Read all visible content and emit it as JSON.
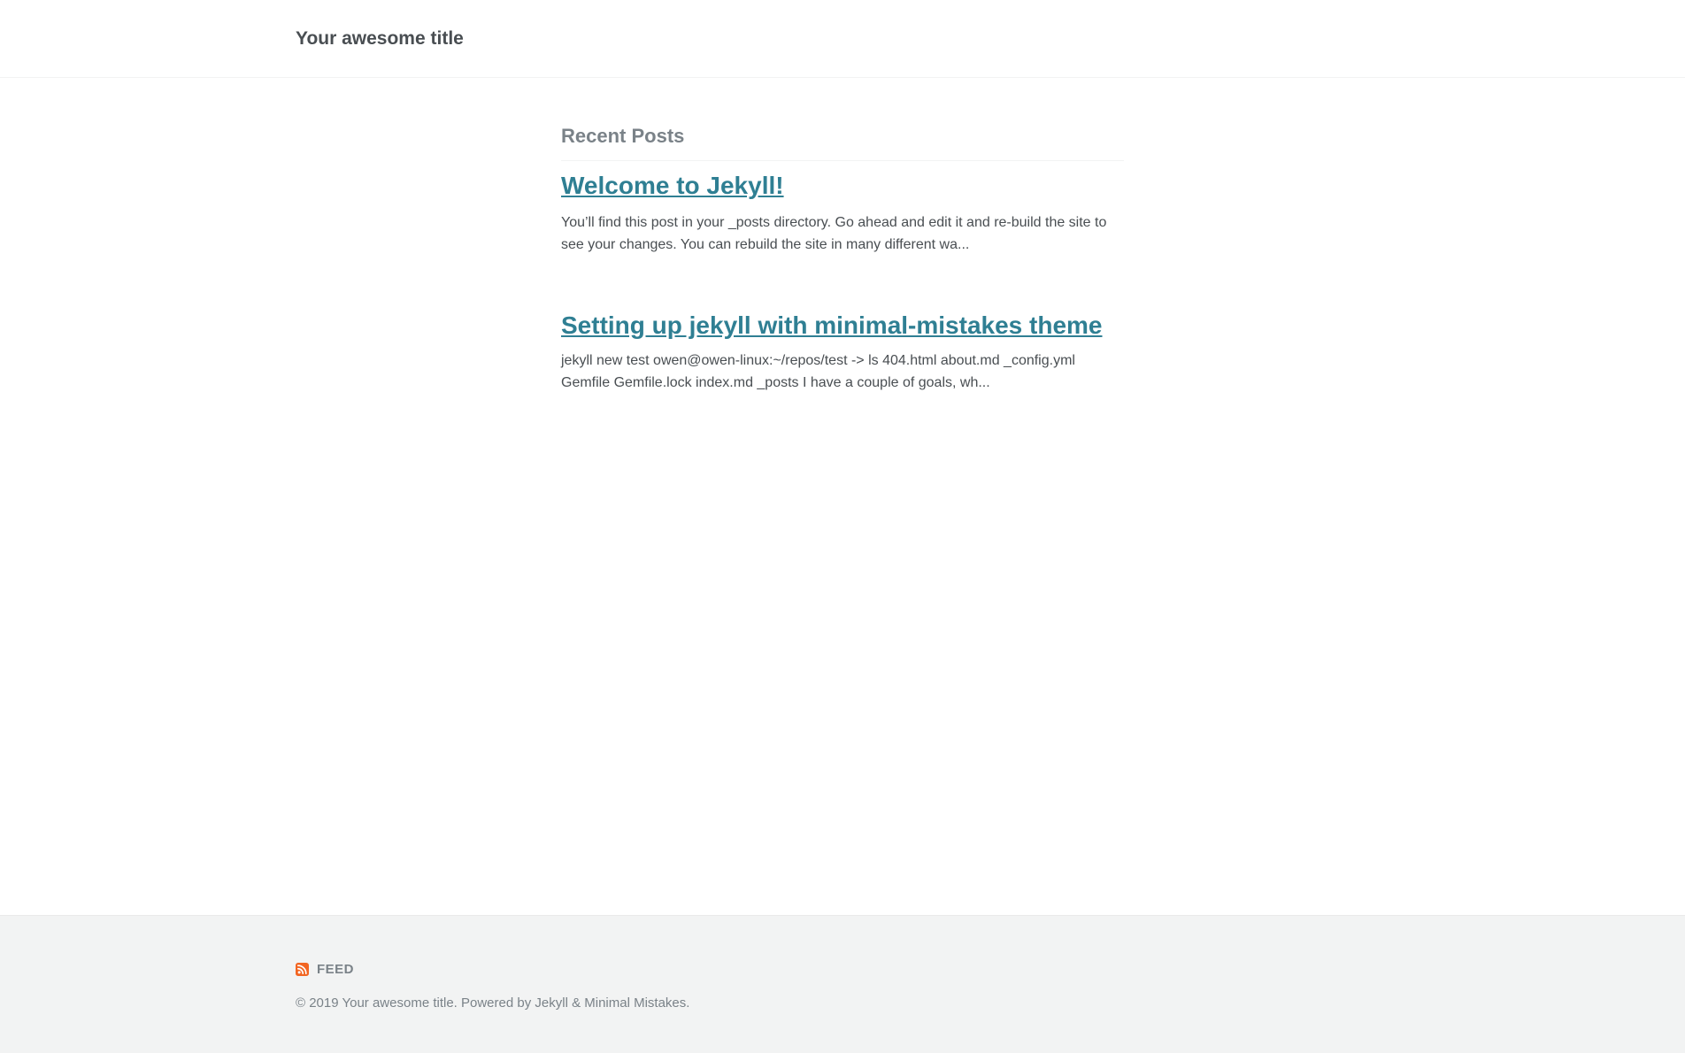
{
  "header": {
    "site_title": "Your awesome title"
  },
  "main": {
    "archive_title": "Recent Posts",
    "posts": [
      {
        "title": "Welcome to Jekyll!",
        "excerpt": "You’ll find this post in your _posts directory. Go ahead and edit it and re-build the site to see your changes. You can rebuild the site in many different wa..."
      },
      {
        "title": "Setting up jekyll with minimal-mistakes theme",
        "excerpt": "jekyll new test owen@owen-linux:~/repos/test -> ls 404.html about.md _config.yml Gemfile Gemfile.lock index.md _posts I have a couple of goals, wh..."
      }
    ]
  },
  "footer": {
    "feed_label": "FEED",
    "copyright_prefix": "© 2019 Your awesome title. Powered by ",
    "jekyll_link": "Jekyll",
    "amp": " & ",
    "mm_link": "Minimal Mistakes",
    "copyright_suffix": ".",
    "icon": "rss-icon",
    "colors": {
      "link": "#2f7f93",
      "text": "#494e52",
      "muted": "#7a8288",
      "footer_bg": "#f2f3f3",
      "rss_orange": "#f26522"
    }
  }
}
